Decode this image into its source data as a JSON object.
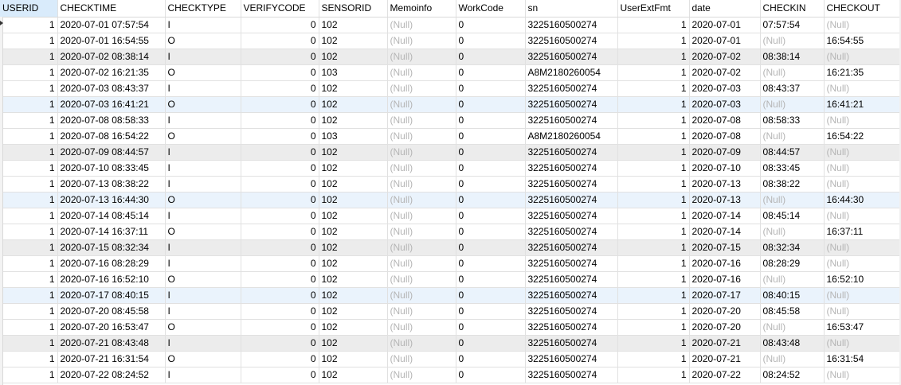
{
  "columns": [
    "USERID",
    "CHECKTIME",
    "CHECKTYPE",
    "VERIFYCODE",
    "SENSORID",
    "Memoinfo",
    "WorkCode",
    "sn",
    "UserExtFmt",
    "date",
    "CHECKIN",
    "CHECKOUT"
  ],
  "null_text": "(Null)",
  "rows": [
    [
      "1",
      "2020-07-01 07:57:54",
      "I",
      "0",
      "102",
      "(Null)",
      "0",
      "3225160500274",
      "1",
      "2020-07-01",
      "07:57:54",
      "(Null)"
    ],
    [
      "1",
      "2020-07-01 16:54:55",
      "O",
      "0",
      "102",
      "(Null)",
      "0",
      "3225160500274",
      "1",
      "2020-07-01",
      "(Null)",
      "16:54:55"
    ],
    [
      "1",
      "2020-07-02 08:38:14",
      "I",
      "0",
      "102",
      "(Null)",
      "0",
      "3225160500274",
      "1",
      "2020-07-02",
      "08:38:14",
      "(Null)"
    ],
    [
      "1",
      "2020-07-02 16:21:35",
      "O",
      "0",
      "103",
      "(Null)",
      "0",
      "A8M2180260054",
      "1",
      "2020-07-02",
      "(Null)",
      "16:21:35"
    ],
    [
      "1",
      "2020-07-03 08:43:37",
      "I",
      "0",
      "102",
      "(Null)",
      "0",
      "3225160500274",
      "1",
      "2020-07-03",
      "08:43:37",
      "(Null)"
    ],
    [
      "1",
      "2020-07-03 16:41:21",
      "O",
      "0",
      "102",
      "(Null)",
      "0",
      "3225160500274",
      "1",
      "2020-07-03",
      "(Null)",
      "16:41:21"
    ],
    [
      "1",
      "2020-07-08 08:58:33",
      "I",
      "0",
      "102",
      "(Null)",
      "0",
      "3225160500274",
      "1",
      "2020-07-08",
      "08:58:33",
      "(Null)"
    ],
    [
      "1",
      "2020-07-08 16:54:22",
      "O",
      "0",
      "103",
      "(Null)",
      "0",
      "A8M2180260054",
      "1",
      "2020-07-08",
      "(Null)",
      "16:54:22"
    ],
    [
      "1",
      "2020-07-09 08:44:57",
      "I",
      "0",
      "102",
      "(Null)",
      "0",
      "3225160500274",
      "1",
      "2020-07-09",
      "08:44:57",
      "(Null)"
    ],
    [
      "1",
      "2020-07-10 08:33:45",
      "I",
      "0",
      "102",
      "(Null)",
      "0",
      "3225160500274",
      "1",
      "2020-07-10",
      "08:33:45",
      "(Null)"
    ],
    [
      "1",
      "2020-07-13 08:38:22",
      "I",
      "0",
      "102",
      "(Null)",
      "0",
      "3225160500274",
      "1",
      "2020-07-13",
      "08:38:22",
      "(Null)"
    ],
    [
      "1",
      "2020-07-13 16:44:30",
      "O",
      "0",
      "102",
      "(Null)",
      "0",
      "3225160500274",
      "1",
      "2020-07-13",
      "(Null)",
      "16:44:30"
    ],
    [
      "1",
      "2020-07-14 08:45:14",
      "I",
      "0",
      "102",
      "(Null)",
      "0",
      "3225160500274",
      "1",
      "2020-07-14",
      "08:45:14",
      "(Null)"
    ],
    [
      "1",
      "2020-07-14 16:37:11",
      "O",
      "0",
      "102",
      "(Null)",
      "0",
      "3225160500274",
      "1",
      "2020-07-14",
      "(Null)",
      "16:37:11"
    ],
    [
      "1",
      "2020-07-15 08:32:34",
      "I",
      "0",
      "102",
      "(Null)",
      "0",
      "3225160500274",
      "1",
      "2020-07-15",
      "08:32:34",
      "(Null)"
    ],
    [
      "1",
      "2020-07-16 08:28:29",
      "I",
      "0",
      "102",
      "(Null)",
      "0",
      "3225160500274",
      "1",
      "2020-07-16",
      "08:28:29",
      "(Null)"
    ],
    [
      "1",
      "2020-07-16 16:52:10",
      "O",
      "0",
      "102",
      "(Null)",
      "0",
      "3225160500274",
      "1",
      "2020-07-16",
      "(Null)",
      "16:52:10"
    ],
    [
      "1",
      "2020-07-17 08:40:15",
      "I",
      "0",
      "102",
      "(Null)",
      "0",
      "3225160500274",
      "1",
      "2020-07-17",
      "08:40:15",
      "(Null)"
    ],
    [
      "1",
      "2020-07-20 08:45:58",
      "I",
      "0",
      "102",
      "(Null)",
      "0",
      "3225160500274",
      "1",
      "2020-07-20",
      "08:45:58",
      "(Null)"
    ],
    [
      "1",
      "2020-07-20 16:53:47",
      "O",
      "0",
      "102",
      "(Null)",
      "0",
      "3225160500274",
      "1",
      "2020-07-20",
      "(Null)",
      "16:53:47"
    ],
    [
      "1",
      "2020-07-21 08:43:48",
      "I",
      "0",
      "102",
      "(Null)",
      "0",
      "3225160500274",
      "1",
      "2020-07-21",
      "08:43:48",
      "(Null)"
    ],
    [
      "1",
      "2020-07-21 16:31:54",
      "O",
      "0",
      "102",
      "(Null)",
      "0",
      "3225160500274",
      "1",
      "2020-07-21",
      "(Null)",
      "16:31:54"
    ],
    [
      "1",
      "2020-07-22 08:24:52",
      "I",
      "0",
      "102",
      "(Null)",
      "0",
      "3225160500274",
      "1",
      "2020-07-22",
      "08:24:52",
      "(Null)"
    ]
  ],
  "colors": {
    "header_active": "#d9ebfb",
    "row_alt": "#ececec",
    "row_highlight": "#eaf3fc",
    "null_text": "#b5b5b5",
    "gridline": "#e1e1e1"
  },
  "icons": {
    "current_row_marker": "row-pointer-icon"
  }
}
